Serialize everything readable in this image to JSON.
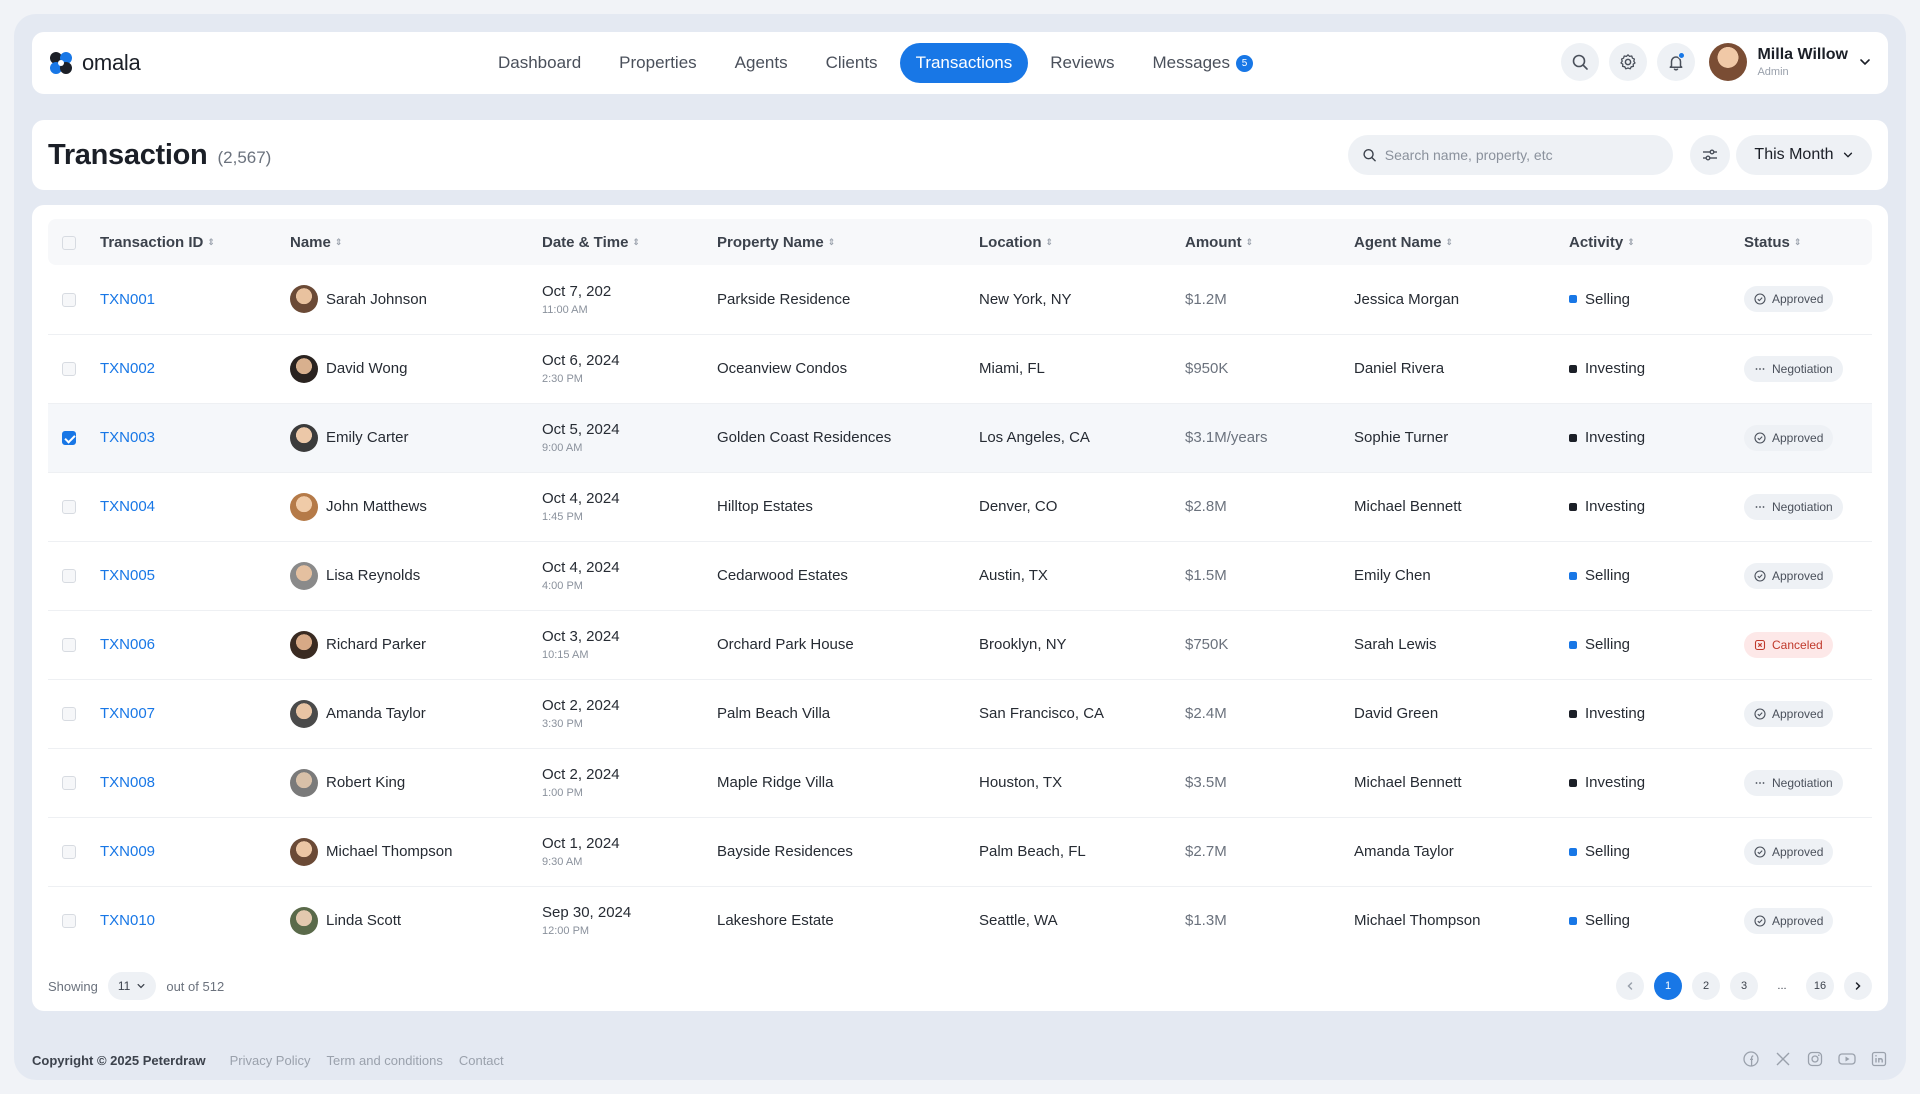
{
  "app": {
    "logo_text": "omala"
  },
  "nav": {
    "items": [
      {
        "label": "Dashboard",
        "active": false
      },
      {
        "label": "Properties",
        "active": false
      },
      {
        "label": "Agents",
        "active": false
      },
      {
        "label": "Clients",
        "active": false
      },
      {
        "label": "Transactions",
        "active": true
      },
      {
        "label": "Reviews",
        "active": false
      },
      {
        "label": "Messages",
        "active": false,
        "badge": "5"
      }
    ]
  },
  "user": {
    "name": "Milla Willow",
    "role": "Admin"
  },
  "header": {
    "title": "Transaction",
    "count": "(2,567)",
    "search_placeholder": "Search name, property, etc",
    "period_label": "This Month"
  },
  "table": {
    "columns": [
      "Transaction ID",
      "Name",
      "Date & Time",
      "Property Name",
      "Location",
      "Amount",
      "Agent Name",
      "Activity",
      "Status"
    ],
    "rows": [
      {
        "id": "TXN001",
        "name": "Sarah Johnson",
        "date": "Oct 7, 202",
        "time": "11:00 AM",
        "property": "Parkside Residence",
        "location": "New York, NY",
        "amount": "$1.2M",
        "agent": "Jessica Morgan",
        "activity": "Selling",
        "status": "Approved",
        "selected": false
      },
      {
        "id": "TXN002",
        "name": "David Wong",
        "date": "Oct 6, 2024",
        "time": "2:30 PM",
        "property": "Oceanview Condos",
        "location": "Miami, FL",
        "amount": "$950K",
        "agent": "Daniel Rivera",
        "activity": "Investing",
        "status": "Negotiation",
        "selected": false
      },
      {
        "id": "TXN003",
        "name": "Emily Carter",
        "date": "Oct 5, 2024",
        "time": "9:00 AM",
        "property": "Golden Coast Residences",
        "location": "Los Angeles, CA",
        "amount": "$3.1M/years",
        "agent": "Sophie Turner",
        "activity": "Investing",
        "status": "Approved",
        "selected": true
      },
      {
        "id": "TXN004",
        "name": "John Matthews",
        "date": "Oct 4, 2024",
        "time": "1:45 PM",
        "property": "Hilltop Estates",
        "location": "Denver, CO",
        "amount": "$2.8M",
        "agent": "Michael Bennett",
        "activity": "Investing",
        "status": "Negotiation",
        "selected": false
      },
      {
        "id": "TXN005",
        "name": "Lisa Reynolds",
        "date": "Oct 4, 2024",
        "time": "4:00 PM",
        "property": "Cedarwood Estates",
        "location": "Austin, TX",
        "amount": "$1.5M",
        "agent": "Emily Chen",
        "activity": "Selling",
        "status": "Approved",
        "selected": false
      },
      {
        "id": "TXN006",
        "name": "Richard Parker",
        "date": "Oct 3, 2024",
        "time": "10:15 AM",
        "property": "Orchard Park House",
        "location": "Brooklyn, NY",
        "amount": "$750K",
        "agent": "Sarah Lewis",
        "activity": "Selling",
        "status": "Canceled",
        "selected": false
      },
      {
        "id": "TXN007",
        "name": "Amanda Taylor",
        "date": "Oct 2, 2024",
        "time": "3:30 PM",
        "property": "Palm Beach Villa",
        "location": "San Francisco, CA",
        "amount": "$2.4M",
        "agent": "David Green",
        "activity": "Investing",
        "status": "Approved",
        "selected": false
      },
      {
        "id": "TXN008",
        "name": "Robert King",
        "date": "Oct 2, 2024",
        "time": "1:00 PM",
        "property": "Maple Ridge Villa",
        "location": "Houston, TX",
        "amount": "$3.5M",
        "agent": "Michael Bennett",
        "activity": "Investing",
        "status": "Negotiation",
        "selected": false
      },
      {
        "id": "TXN009",
        "name": "Michael Thompson",
        "date": "Oct 1, 2024",
        "time": "9:30 AM",
        "property": "Bayside Residences",
        "location": "Palm Beach, FL",
        "amount": "$2.7M",
        "agent": "Amanda Taylor",
        "activity": "Selling",
        "status": "Approved",
        "selected": false
      },
      {
        "id": "TXN010",
        "name": "Linda Scott",
        "date": "Sep 30, 2024",
        "time": "12:00 PM",
        "property": "Lakeshore Estate",
        "location": "Seattle, WA",
        "amount": "$1.3M",
        "agent": "Michael Thompson",
        "activity": "Selling",
        "status": "Approved",
        "selected": false
      }
    ]
  },
  "pagination": {
    "showing_label": "Showing",
    "per_page": "11",
    "out_of": "out of 512",
    "pages": [
      "1",
      "2",
      "3",
      "...",
      "16"
    ],
    "current": "1"
  },
  "footer": {
    "copyright": "Copyright © 2025 Peterdraw",
    "links": [
      "Privacy Policy",
      "Term and conditions",
      "Contact"
    ],
    "socials": [
      "facebook-icon",
      "x-icon",
      "instagram-icon",
      "youtube-icon",
      "linkedin-icon"
    ]
  },
  "colors": {
    "accent": "#1877e6",
    "selling": "#1877e6",
    "investing": "#1b1f27",
    "canceled": "#c0392b"
  }
}
